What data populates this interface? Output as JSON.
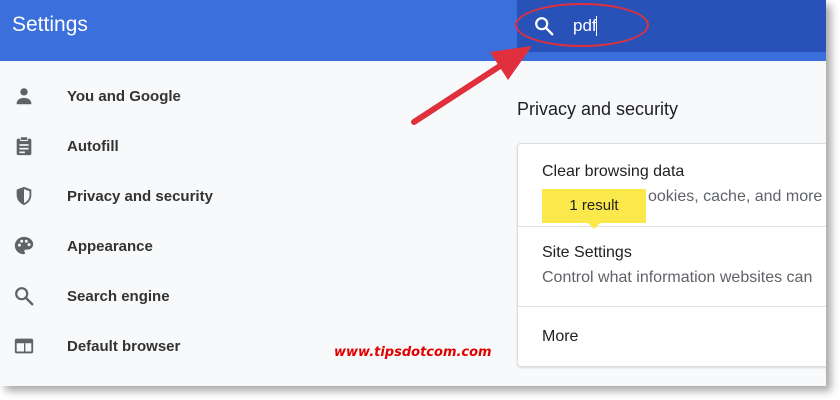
{
  "header": {
    "title": "Settings"
  },
  "search": {
    "query": "pdf"
  },
  "sidebar": {
    "items": [
      {
        "label": "You and Google",
        "icon": "person-icon"
      },
      {
        "label": "Autofill",
        "icon": "clipboard-icon"
      },
      {
        "label": "Privacy and security",
        "icon": "shield-icon"
      },
      {
        "label": "Appearance",
        "icon": "palette-icon"
      },
      {
        "label": "Search engine",
        "icon": "search-icon"
      },
      {
        "label": "Default browser",
        "icon": "browser-window-icon"
      }
    ]
  },
  "main": {
    "section_title": "Privacy and security",
    "rows": [
      {
        "title": "Clear browsing data",
        "subtitle": "ookies, cache, and more"
      },
      {
        "title": "Site Settings",
        "subtitle": "Control what information websites can"
      },
      {
        "title": "More"
      }
    ],
    "result_badge": "1 result"
  },
  "watermark": "www.tipsdotcom.com",
  "colors": {
    "header": "#3b6fdb",
    "search_bar": "#2952b8",
    "annotation_red": "#e0303d",
    "badge_yellow": "#fbe94b"
  }
}
